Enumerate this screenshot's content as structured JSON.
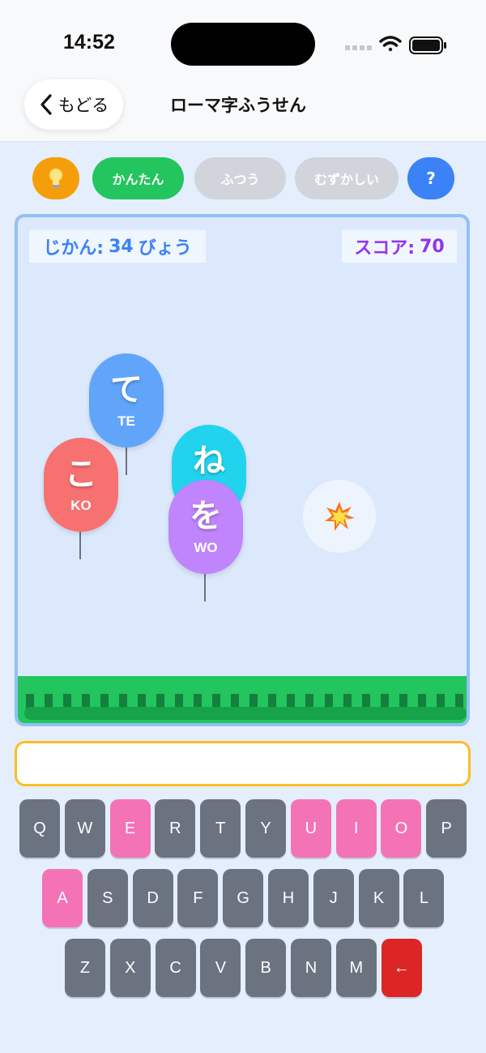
{
  "status_bar": {
    "time": "14:52"
  },
  "nav": {
    "back_label": "もどる",
    "title": "ローマ字ふうせん"
  },
  "difficulty": {
    "hint_icon": "lightbulb-icon",
    "levels": [
      {
        "label": "かんたん",
        "selected": true
      },
      {
        "label": "ふつう",
        "selected": false
      },
      {
        "label": "むずかしい",
        "selected": false
      }
    ],
    "help_label": "?"
  },
  "game": {
    "time_label": "じかん:",
    "time_value": "34",
    "time_unit": "びょう",
    "score_label": "スコア:",
    "score_value": "70",
    "balloons": [
      {
        "kana": "て",
        "romaji": "TE",
        "color": "#60a5fa"
      },
      {
        "kana": "こ",
        "romaji": "KO",
        "color": "#f87171"
      },
      {
        "kana": "ね",
        "romaji": "",
        "color": "#22d3ee"
      },
      {
        "kana": "を",
        "romaji": "WO",
        "color": "#c084fc"
      }
    ],
    "burst_icon": "collision-icon"
  },
  "input": {
    "value": "",
    "placeholder": ""
  },
  "keyboard": {
    "rows": [
      [
        "Q",
        "W",
        "E",
        "R",
        "T",
        "Y",
        "U",
        "I",
        "O",
        "P"
      ],
      [
        "A",
        "S",
        "D",
        "F",
        "G",
        "H",
        "J",
        "K",
        "L"
      ],
      [
        "Z",
        "X",
        "C",
        "V",
        "B",
        "N",
        "M",
        "←"
      ]
    ],
    "vowel_color": "#f472b6",
    "key_color": "#6b7280",
    "backspace_color": "#dc2626"
  },
  "colors": {
    "accent_green": "#22c55e",
    "hint_orange": "#f59e0b",
    "help_blue": "#3b82f6",
    "time_blue": "#3b82f6",
    "score_purple": "#9333ea",
    "input_border": "#fbbf24"
  }
}
